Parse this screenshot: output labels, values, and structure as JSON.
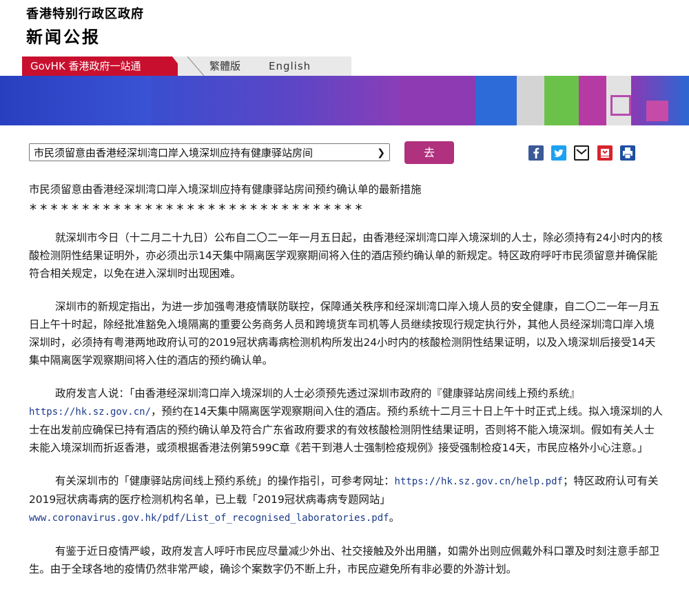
{
  "header": {
    "line1": "香港特别行政区政府",
    "line2": "新闻公报"
  },
  "nav": {
    "govhk": "GovHK 香港政府一站通",
    "traditional": "繁體版",
    "english": "English"
  },
  "toolbar": {
    "select_value": "市民须留意由香港经深圳湾口岸入境深圳应持有健康驿站房间",
    "go_label": "去",
    "share_icons": [
      "facebook-icon",
      "twitter-icon",
      "email-icon",
      "bookmark-icon",
      "print-icon"
    ]
  },
  "article": {
    "title": "市民须留意由香港经深圳湾口岸入境深圳应持有健康驿站房间预约确认单的最新措施",
    "stars": "********************************",
    "p1": "就深圳市今日（十二月二十九日）公布自二〇二一年一月五日起，由香港经深圳湾口岸入境深圳的人士，除必须持有24小时内的核酸检测阴性结果证明外，亦必须出示14天集中隔离医学观察期间将入住的酒店预约确认单的新规定。特区政府呼吁市民须留意并确保能符合相关规定，以免在进入深圳时出现困难。",
    "p2": "深圳市的新规定指出，为进一步加强粤港疫情联防联控，保障通关秩序和经深圳湾口岸入境人员的安全健康，自二〇二一年一月五日上午十时起，除经批准豁免入境隔离的重要公务商务人员和跨境货车司机等人员继续按现行规定执行外，其他人员经深圳湾口岸入境深圳时，必须持有粤港两地政府认可的2019冠状病毒病检测机构所发出24小时内的核酸检测阴性结果证明，以及入境深圳后接受14天集中隔离医学观察期间将入住的酒店的预约确认单。",
    "p3_a": "政府发言人说：「由香港经深圳湾口岸入境深圳的人士必须预先透过深圳市政府的『健康驿站房间线上预约系统』",
    "p3_url": "https://hk.sz.gov.cn/",
    "p3_b": "，预约在14天集中隔离医学观察期间入住的酒店。预约系统十二月三十日上午十时正式上线。拟入境深圳的人士在出发前应确保已持有酒店的预约确认单及符合广东省政府要求的有效核酸检测阴性结果证明，否则将不能入境深圳。假如有关人士未能入境深圳而折返香港，或须根据香港法例第599C章《若干到港人士强制检疫规例》接受强制检疫14天，市民应格外小心注意。」",
    "p4_a": "有关深圳市的「健康驿站房间线上预约系统」的操作指引，可参考网址：",
    "p4_url1": "https://hk.sz.gov.cn/help.pdf",
    "p4_b": "；特区政府认可有关2019冠状病毒病的医疗检测机构名单，已上载「2019冠状病毒病专题网站」",
    "p4_url2": "www.coronavirus.gov.hk/pdf/List_of_recognised_laboratories.pdf",
    "p4_c": "。",
    "p5": "有鉴于近日疫情严峻，政府发言人呼吁市民应尽量减少外出、社交接触及外出用膳，如需外出则应佩戴外科口罩及时刻注意手部卫生。由于全球各地的疫情仍然非常严峻，确诊个案数字仍不断上升，市民应避免所有非必要的外游计划。"
  },
  "colors": {
    "brand_red": "#c8102e",
    "go_button": "#b0317d",
    "banner_blue": "#2a48c4"
  }
}
